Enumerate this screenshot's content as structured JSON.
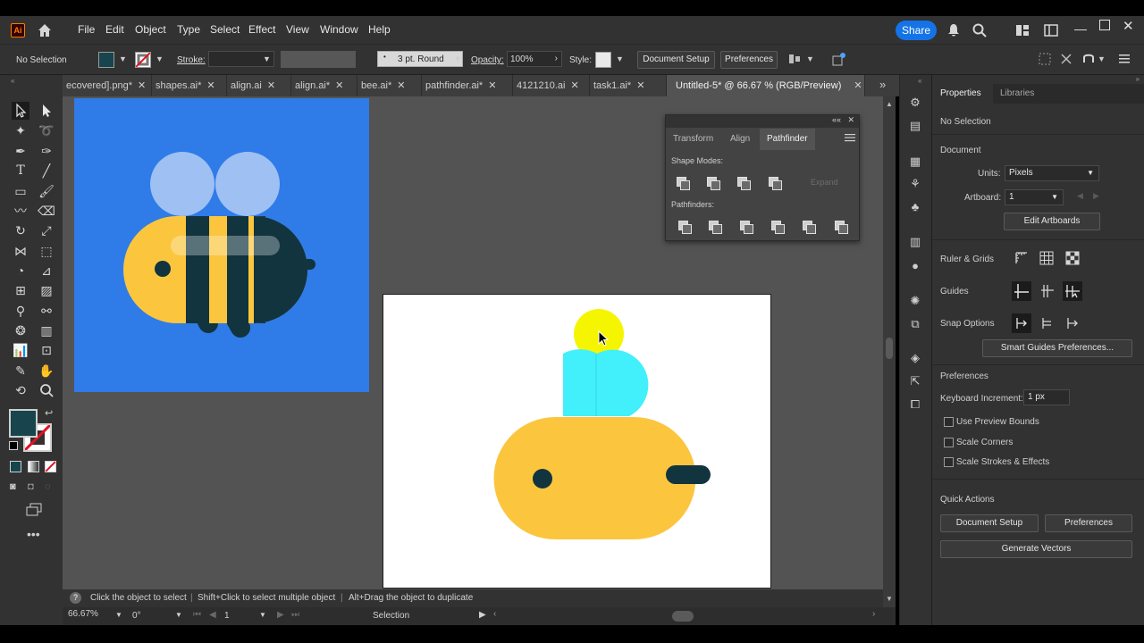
{
  "app": {
    "logo": "Ai",
    "menu": [
      "File",
      "Edit",
      "Object",
      "Type",
      "Select",
      "Effect",
      "View",
      "Window",
      "Help"
    ],
    "share_label": "Share"
  },
  "control": {
    "selection": "No Selection",
    "stroke_label": "Stroke:",
    "brush": "3 pt. Round",
    "opacity_label": "Opacity:",
    "opacity_value": "100%",
    "style_label": "Style:",
    "document_setup": "Document Setup",
    "preferences": "Preferences",
    "fill_color": "#17444d"
  },
  "tabs": [
    {
      "label": "ecovered].png*",
      "active": false
    },
    {
      "label": "shapes.ai*",
      "active": false
    },
    {
      "label": "align.ai",
      "active": false
    },
    {
      "label": "align.ai*",
      "active": false
    },
    {
      "label": "bee.ai*",
      "active": false
    },
    {
      "label": "pathfinder.ai*",
      "active": false
    },
    {
      "label": "4121210.ai",
      "active": false
    },
    {
      "label": "task1.ai*",
      "active": false
    },
    {
      "label": "Untitled-5* @ 66.67 % (RGB/Preview)",
      "active": true
    }
  ],
  "pathfinder_panel": {
    "tabs": [
      "Transform",
      "Align",
      "Pathfinder"
    ],
    "active_tab": "Pathfinder",
    "shape_modes_label": "Shape Modes:",
    "expand_label": "Expand",
    "pathfinders_label": "Pathfinders:"
  },
  "properties": {
    "tabs": [
      "Properties",
      "Libraries"
    ],
    "selection": "No Selection",
    "document_section": "Document",
    "units_label": "Units:",
    "units_value": "Pixels",
    "artboard_label": "Artboard:",
    "artboard_value": "1",
    "edit_artboards": "Edit Artboards",
    "ruler_grids": "Ruler & Grids",
    "guides": "Guides",
    "snap_options": "Snap Options",
    "smart_guides": "Smart Guides Preferences...",
    "preferences_section": "Preferences",
    "keyboard_increment_label": "Keyboard Increment:",
    "keyboard_increment_value": "1 px",
    "checkboxes": [
      "Use Preview Bounds",
      "Scale Corners",
      "Scale Strokes & Effects"
    ],
    "quick_actions": "Quick Actions",
    "document_setup": "Document Setup",
    "preferences": "Preferences",
    "generate_vectors": "Generate Vectors"
  },
  "status": {
    "hint1": "Click the object to select",
    "hint2": "Shift+Click to select multiple object",
    "hint3": "Alt+Drag the object to duplicate",
    "zoom": "66.67%",
    "rotation": "0°",
    "artboard": "1",
    "tool": "Selection"
  },
  "colors": {
    "canvas_bg": "#535353",
    "reference_bg": "#2f7be8",
    "wing_light": "#9ec0f3",
    "bee_body": "#fbc63e",
    "bee_dark": "#12343f",
    "cyan_wing": "#41f0fb",
    "yellow_head": "#f5f500"
  }
}
